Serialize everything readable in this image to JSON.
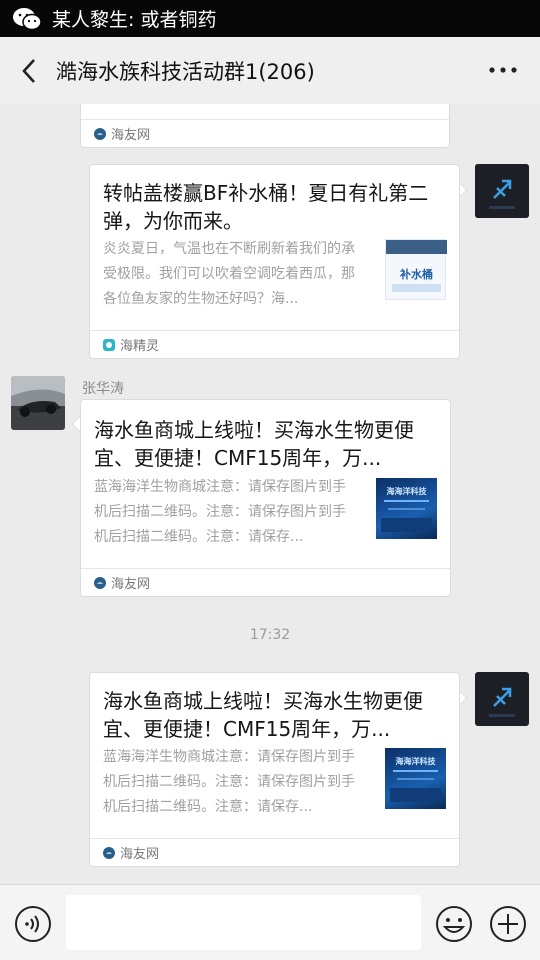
{
  "notification": {
    "text": "某人黎生: 或者铜药"
  },
  "header": {
    "title": "澔海水族科技活动群1(206)"
  },
  "messages": [
    {
      "source": "海友网"
    },
    {
      "title": "转帖盖楼赢BF补水桶！夏日有礼第二弹，为你而来。",
      "desc": "炎炎夏日，气温也在不断刷新着我们的承受极限。我们可以吹着空调吃着西瓜，那各位鱼友家的生物还好吗？海...",
      "thumb_text": "补水桶",
      "source": "海精灵"
    },
    {
      "sender": "张华涛",
      "title": "海水鱼商城上线啦！买海水生物更便宜、更便捷！CMF15周年，万...",
      "desc": "蓝海海洋生物商城注意：请保存图片到手机后扫描二维码。注意：请保存图片到手机后扫描二维码。注意：请保存...",
      "thumb_text": "海海洋科技",
      "source": "海友网"
    },
    {
      "time": "17:32"
    },
    {
      "title": "海水鱼商城上线啦！买海水生物更便宜、更便捷！CMF15周年，万...",
      "desc": "蓝海海洋生物商城注意：请保存图片到手机后扫描二维码。注意：请保存图片到手机后扫描二维码。注意：请保存...",
      "thumb_text": "海海洋科技",
      "source": "海友网"
    }
  ],
  "colors": {
    "source_icon_blue": "#2b5f8a",
    "source_icon_teal": "#2bb6c8",
    "avatar_bg": "#1b1d22",
    "avatar_accent": "#3aa0e8"
  },
  "icons": {
    "back": "chevron-left-icon",
    "more": "more-dots-icon",
    "voice": "voice-icon",
    "emoji": "emoji-icon",
    "plus": "plus-icon"
  }
}
